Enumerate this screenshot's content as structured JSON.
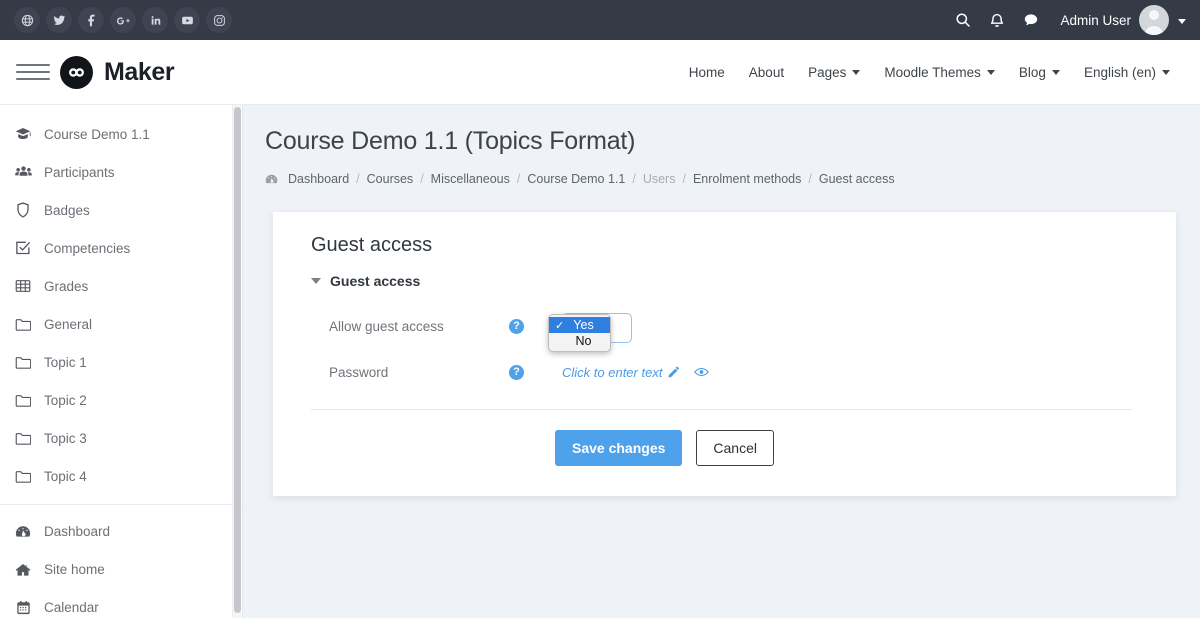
{
  "topbar": {
    "social": [
      {
        "name": "website-icon",
        "label": "Website"
      },
      {
        "name": "twitter-icon",
        "label": "Twitter"
      },
      {
        "name": "facebook-icon",
        "label": "Facebook"
      },
      {
        "name": "google-plus-icon",
        "label": "Google Plus"
      },
      {
        "name": "linkedin-icon",
        "label": "LinkedIn"
      },
      {
        "name": "youtube-icon",
        "label": "YouTube"
      },
      {
        "name": "instagram-icon",
        "label": "Instagram"
      }
    ],
    "search_icon": "search-icon",
    "bell_icon": "bell-icon",
    "message_icon": "message-icon",
    "user_name": "Admin User",
    "background_color": "#343a46"
  },
  "navbar": {
    "menu_icon": "hamburger-icon",
    "brand": "Maker",
    "links": [
      {
        "label": "Home",
        "has_caret": false
      },
      {
        "label": "About",
        "has_caret": false
      },
      {
        "label": "Pages",
        "has_caret": true
      },
      {
        "label": "Moodle Themes",
        "has_caret": true
      },
      {
        "label": "Blog",
        "has_caret": true
      },
      {
        "label": "English (en)",
        "has_caret": true
      }
    ]
  },
  "sidebar": {
    "items": [
      {
        "label": "Course Demo 1.1",
        "icon": "graduation-cap-icon"
      },
      {
        "label": "Participants",
        "icon": "users-icon"
      },
      {
        "label": "Badges",
        "icon": "shield-icon"
      },
      {
        "label": "Competencies",
        "icon": "check-square-icon"
      },
      {
        "label": "Grades",
        "icon": "table-icon"
      },
      {
        "label": "General",
        "icon": "folder-icon"
      },
      {
        "label": "Topic 1",
        "icon": "folder-icon"
      },
      {
        "label": "Topic 2",
        "icon": "folder-icon"
      },
      {
        "label": "Topic 3",
        "icon": "folder-icon"
      },
      {
        "label": "Topic 4",
        "icon": "folder-icon"
      }
    ],
    "items2": [
      {
        "label": "Dashboard",
        "icon": "dashboard-icon"
      },
      {
        "label": "Site home",
        "icon": "home-icon"
      },
      {
        "label": "Calendar",
        "icon": "calendar-icon"
      }
    ]
  },
  "main": {
    "page_title": "Course Demo 1.1 (Topics Format)",
    "breadcrumb": [
      {
        "label": "Dashboard",
        "muted": false
      },
      {
        "label": "Courses",
        "muted": false
      },
      {
        "label": "Miscellaneous",
        "muted": false
      },
      {
        "label": "Course Demo 1.1",
        "muted": false
      },
      {
        "label": "Users",
        "muted": true
      },
      {
        "label": "Enrolment methods",
        "muted": false
      },
      {
        "label": "Guest access",
        "muted": false
      }
    ],
    "breadcrumb_separator": "/",
    "breadcrumb_icon": "dashboard-icon"
  },
  "card": {
    "title": "Guest access",
    "section_title": "Guest access",
    "rows": [
      {
        "label": "Allow guest access",
        "help": "?"
      },
      {
        "label": "Password",
        "help": "?"
      }
    ],
    "select": {
      "value": "Yes",
      "options": [
        {
          "label": "Yes",
          "selected": true
        },
        {
          "label": "No",
          "selected": false
        }
      ],
      "checkmark": "✓"
    },
    "password": {
      "placeholder_text": "Click to enter text",
      "edit_icon": "pencil-icon",
      "reveal_icon": "eye-icon"
    },
    "buttons": {
      "save": "Save changes",
      "cancel": "Cancel"
    },
    "accent_color": "#4ea1eb"
  }
}
